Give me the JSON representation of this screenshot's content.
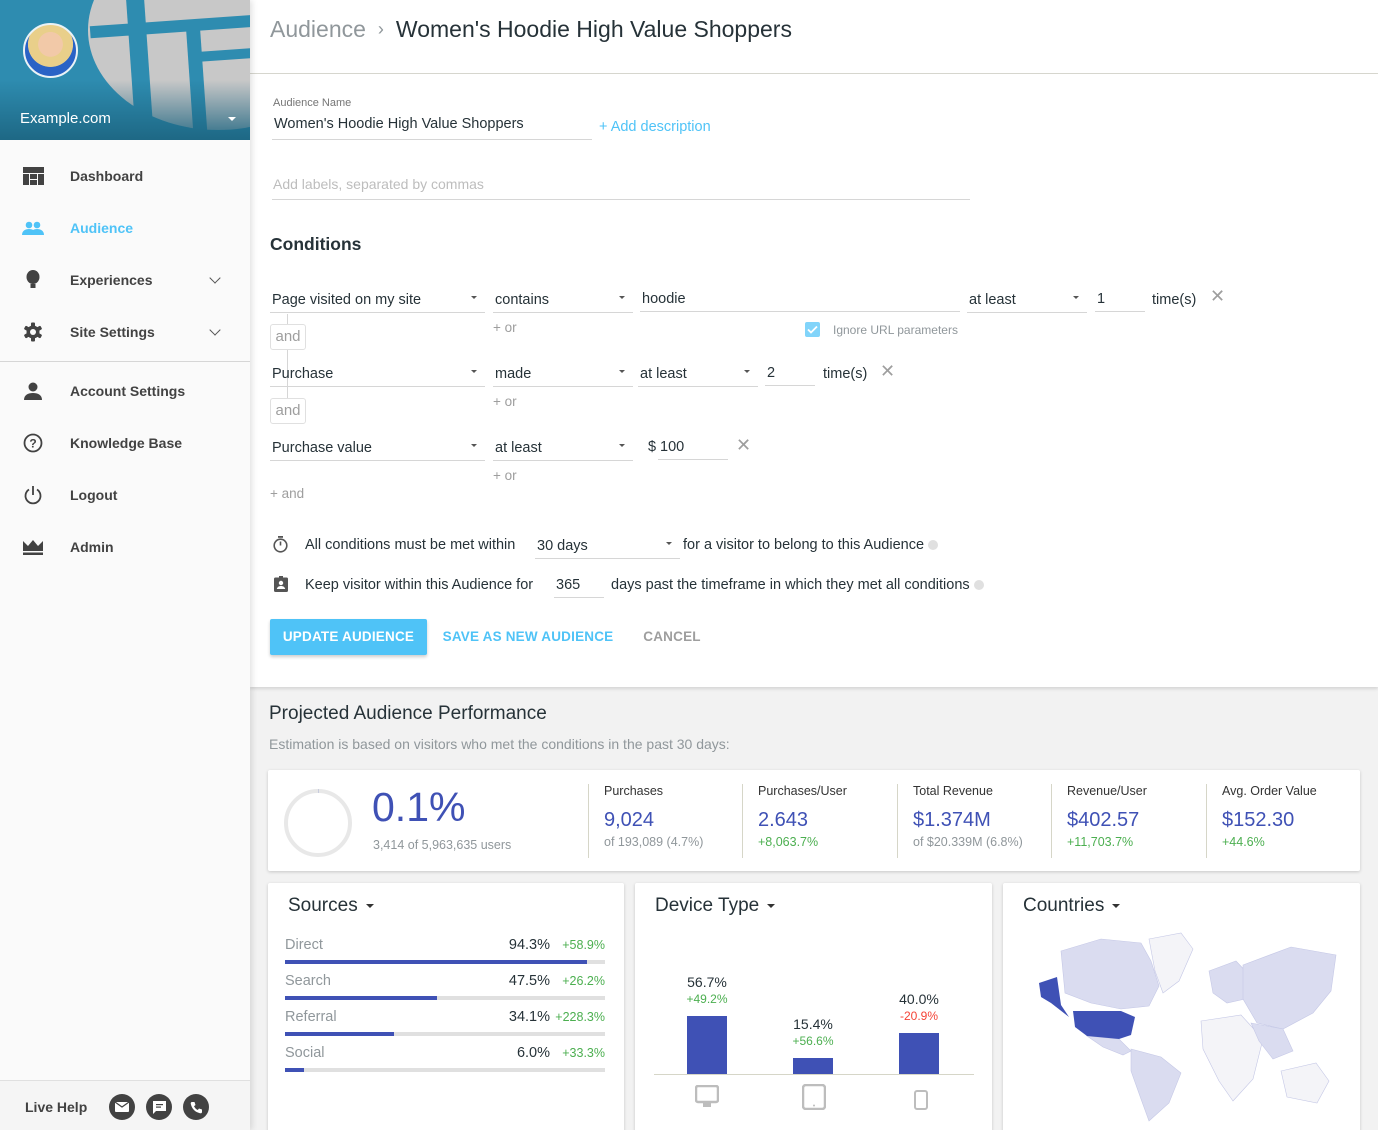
{
  "sidebar": {
    "site_name": "Example.com",
    "items": [
      {
        "label": "Dashboard",
        "icon": "dashboard-icon"
      },
      {
        "label": "Audience",
        "icon": "people-icon",
        "active": true
      },
      {
        "label": "Experiences",
        "icon": "balloon-icon",
        "expandable": true
      },
      {
        "label": "Site Settings",
        "icon": "gear-icon",
        "expandable": true
      },
      {
        "label": "Account Settings",
        "icon": "person-icon"
      },
      {
        "label": "Knowledge Base",
        "icon": "help-circle-icon"
      },
      {
        "label": "Logout",
        "icon": "power-icon"
      },
      {
        "label": "Admin",
        "icon": "crown-icon"
      }
    ],
    "live_help": {
      "label": "Live Help",
      "buttons": [
        "email-icon",
        "chat-icon",
        "phone-icon"
      ]
    }
  },
  "header": {
    "breadcrumb_parent": "Audience",
    "breadcrumb_sep": "›",
    "title": "Women's Hoodie High Value Shoppers"
  },
  "form": {
    "name_label": "Audience Name",
    "name_value": "Women's Hoodie High Value Shoppers",
    "add_description": "+ Add description",
    "labels_placeholder": "Add labels, separated by commas",
    "conditions_heading": "Conditions",
    "and_label": "and",
    "or_label": "+ or",
    "add_and": "+ and",
    "times_label": "time(s)",
    "conditions": [
      {
        "type": "Page visited on my site",
        "operator": "contains",
        "value": "hoodie",
        "freq": "at least",
        "count": "1",
        "ignore_url_params_label": "Ignore URL parameters",
        "ignore_url_params": true
      },
      {
        "type": "Purchase",
        "operator": "made",
        "freq": "at least",
        "count": "2"
      },
      {
        "type": "Purchase value",
        "operator": "at least",
        "currency": "$",
        "value": "100"
      }
    ],
    "timeframe": {
      "prefix": "All conditions must be met within",
      "value": "30 days",
      "suffix": "for a visitor to belong to this Audience"
    },
    "retention": {
      "prefix": "Keep visitor within this Audience for",
      "value": "365",
      "suffix": "days past the timeframe in which they met all conditions"
    },
    "buttons": {
      "update": "Update Audience",
      "save_new": "Save as New Audience",
      "cancel": "Cancel"
    }
  },
  "performance": {
    "title": "Projected Audience Performance",
    "subtitle": "Estimation is based on visitors who met the conditions in the past 30 days:",
    "reach": {
      "value": "0.1%",
      "sub": "3,414 of 5,963,635 users",
      "fraction": 0.001
    },
    "stats": [
      {
        "title": "Purchases",
        "value": "9,024",
        "sub": "of 193,089 (4.7%)",
        "positive": false
      },
      {
        "title": "Purchases/User",
        "value": "2.643",
        "sub": "+8,063.7%",
        "positive": true
      },
      {
        "title": "Total Revenue",
        "value": "$1.374M",
        "sub": "of $20.339M (6.8%)",
        "positive": false
      },
      {
        "title": "Revenue/User",
        "value": "$402.57",
        "sub": "+11,703.7%",
        "positive": true
      },
      {
        "title": "Avg. Order Value",
        "value": "$152.30",
        "sub": "+44.6%",
        "positive": true
      }
    ],
    "sources": {
      "title": "Sources",
      "rows": [
        {
          "name": "Direct",
          "pct": "94.3%",
          "value": 94.3,
          "change": "+58.9%"
        },
        {
          "name": "Search",
          "pct": "47.5%",
          "value": 47.5,
          "change": "+26.2%"
        },
        {
          "name": "Referral",
          "pct": "34.1%",
          "value": 34.1,
          "change": "+228.3%"
        },
        {
          "name": "Social",
          "pct": "6.0%",
          "value": 6.0,
          "change": "+33.3%"
        }
      ]
    },
    "devices": {
      "title": "Device Type",
      "rows": [
        {
          "device": "desktop",
          "icon": "desktop-icon",
          "pct": "56.7%",
          "value": 56.7,
          "change": "+49.2%",
          "negative": false
        },
        {
          "device": "tablet",
          "icon": "tablet-icon",
          "pct": "15.4%",
          "value": 15.4,
          "change": "+56.6%",
          "negative": false
        },
        {
          "device": "mobile",
          "icon": "mobile-icon",
          "pct": "40.0%",
          "value": 40.0,
          "change": "-20.9%",
          "negative": true
        }
      ]
    },
    "countries": {
      "title": "Countries",
      "highlighted": "United States"
    }
  },
  "colors": {
    "accent": "#4fc3f7",
    "primary": "#3f51b5",
    "positive": "#4caf50",
    "negative": "#f44336"
  }
}
